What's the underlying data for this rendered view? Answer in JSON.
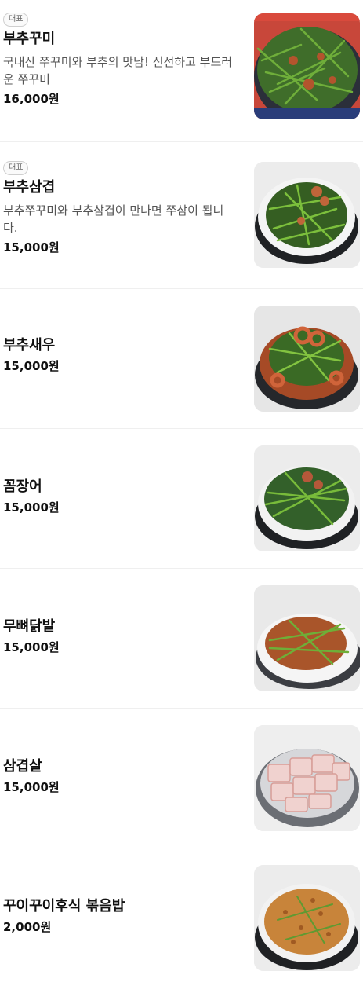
{
  "items": [
    {
      "badge": "대표",
      "name": "부추꾸미",
      "desc": "국내산 쭈꾸미와 부추의 맛남! 신선하고 부드러운 쭈꾸미",
      "price": "16,000원"
    },
    {
      "badge": "대표",
      "name": "부추삼겹",
      "desc": "부추쭈꾸미와 부추삼겹이 만나면 쭈삼이 됩니다.",
      "price": "15,000원"
    },
    {
      "name": "부추새우",
      "price": "15,000원"
    },
    {
      "name": "꼼장어",
      "price": "15,000원"
    },
    {
      "name": "무뼈닭발",
      "price": "15,000원"
    },
    {
      "name": "삼겹살",
      "price": "15,000원"
    },
    {
      "name": "꾸이꾸이후식 볶음밥",
      "price": "2,000원"
    }
  ],
  "images": [
    "stir-fried-webfoot-octopus-with-chives",
    "pork-belly-with-chives",
    "shrimp-with-chives",
    "eel-with-chives",
    "boneless-chicken-feet-with-chives",
    "raw-pork-belly",
    "fried-rice"
  ]
}
